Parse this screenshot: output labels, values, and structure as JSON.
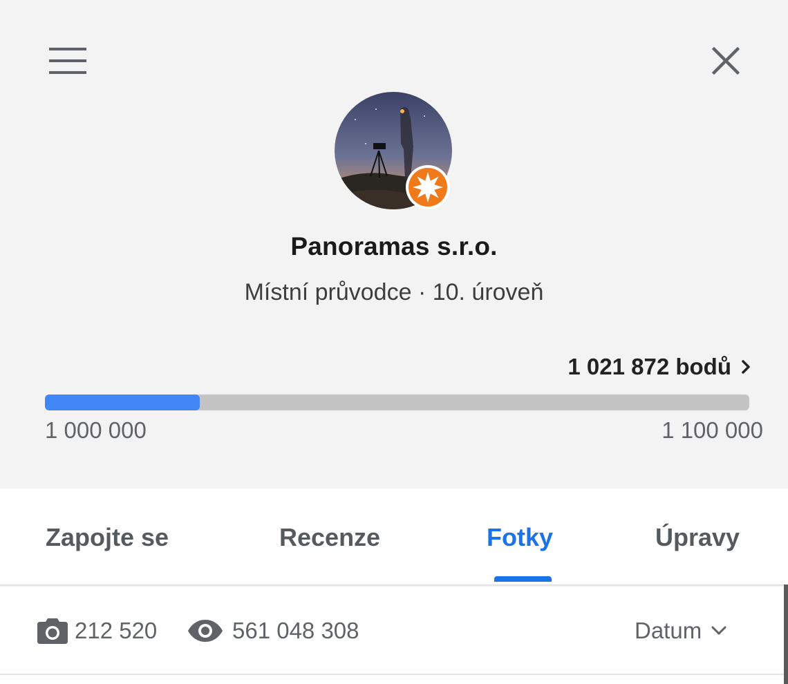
{
  "header": {
    "menu_icon": "hamburger-menu-icon",
    "close_icon": "close-icon",
    "profile_name": "Panoramas s.r.o.",
    "profile_subtitle": "Místní průvodce · 10. úroveň",
    "badge_icon": "local-guide-star-badge-icon"
  },
  "points": {
    "label": "1 021 872 bodů",
    "arrow_icon": "chevron-right-icon",
    "range_min": "1 000 000",
    "range_max": "1 100 000",
    "progress_fraction": 0.22
  },
  "tabs": [
    {
      "label": "Zapojte se",
      "active": false
    },
    {
      "label": "Recenze",
      "active": false
    },
    {
      "label": "Fotky",
      "active": true
    },
    {
      "label": "Úpravy",
      "active": false
    }
  ],
  "stats": {
    "photos_icon": "camera-icon",
    "photos_count": "212 520",
    "views_icon": "eye-icon",
    "views_count": "561 048 308",
    "sort_label": "Datum",
    "sort_icon": "chevron-down-icon"
  },
  "colors": {
    "accent": "#1a73e8",
    "progress_fill": "#4285f4",
    "badge": "#f07a1a"
  }
}
